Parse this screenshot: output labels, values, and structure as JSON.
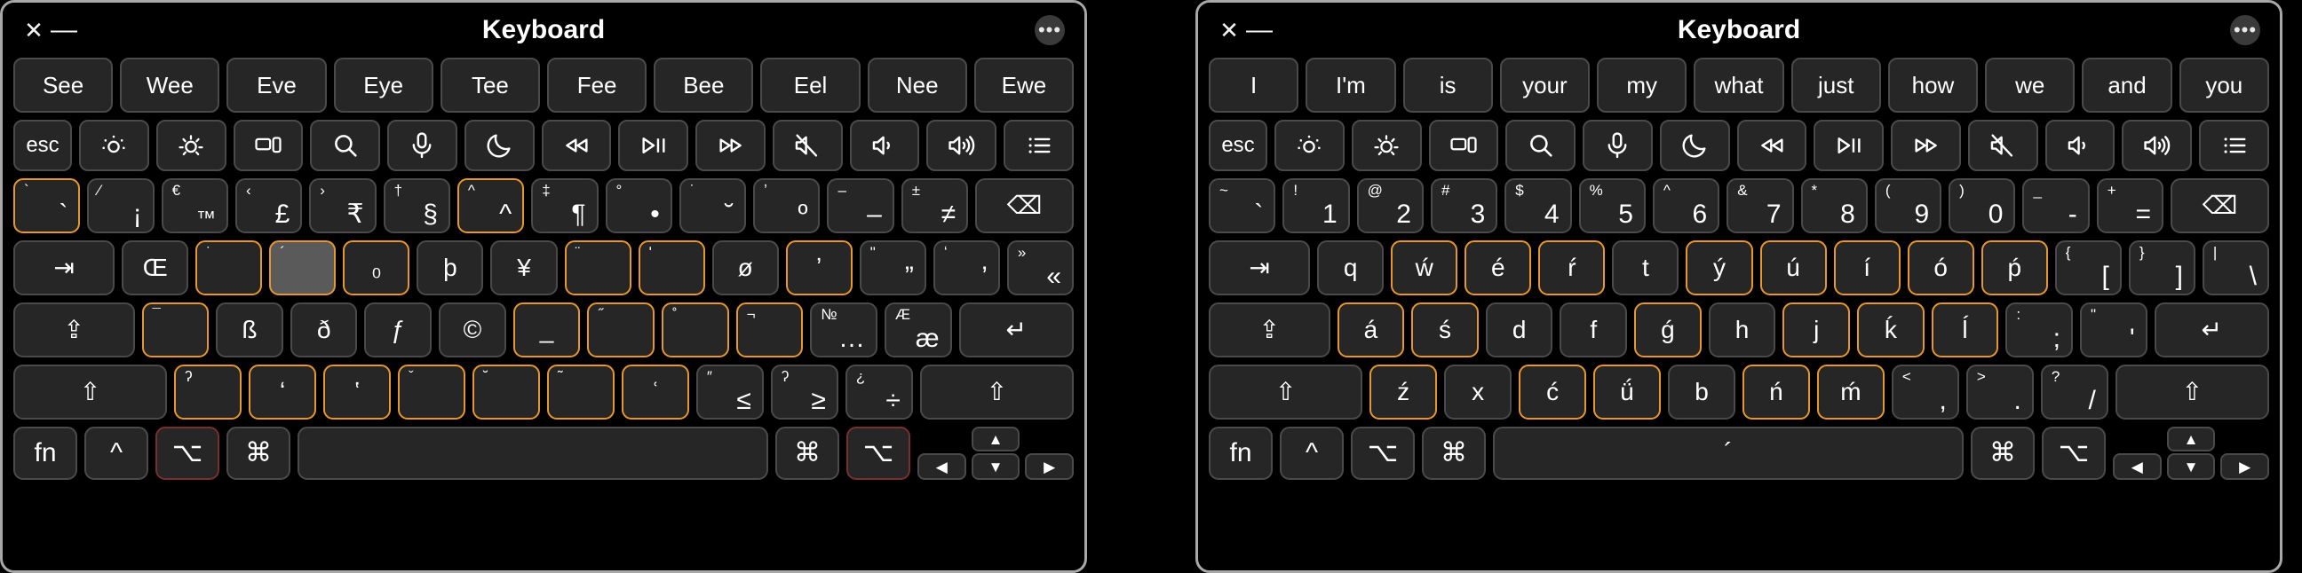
{
  "windows": [
    {
      "id": "left",
      "title": "Keyboard",
      "controls": {
        "close": "✕",
        "minimize": "—",
        "more": "•••"
      },
      "suggestions": [
        "See",
        "Wee",
        "Eve",
        "Eye",
        "Tee",
        "Fee",
        "Bee",
        "Eel",
        "Nee",
        "Ewe"
      ],
      "function_row": [
        {
          "label": "esc",
          "icon": "",
          "name": "escape-key"
        },
        {
          "label": "",
          "icon": "brightness-down-icon",
          "name": "brightness-down-key"
        },
        {
          "label": "",
          "icon": "brightness-up-icon",
          "name": "brightness-up-key"
        },
        {
          "label": "",
          "icon": "mission-control-icon",
          "name": "mission-control-key"
        },
        {
          "label": "",
          "icon": "search-icon",
          "name": "spotlight-key"
        },
        {
          "label": "",
          "icon": "microphone-icon",
          "name": "dictation-key"
        },
        {
          "label": "",
          "icon": "moon-icon",
          "name": "do-not-disturb-key"
        },
        {
          "label": "",
          "icon": "rewind-icon",
          "name": "rewind-key"
        },
        {
          "label": "",
          "icon": "playpause-icon",
          "name": "play-pause-key"
        },
        {
          "label": "",
          "icon": "fastforward-icon",
          "name": "fast-forward-key"
        },
        {
          "label": "",
          "icon": "mute-icon",
          "name": "mute-key"
        },
        {
          "label": "",
          "icon": "volume-down-icon",
          "name": "volume-down-key"
        },
        {
          "label": "",
          "icon": "volume-up-icon",
          "name": "volume-up-key"
        },
        {
          "label": "",
          "icon": "list-icon",
          "name": "list-key"
        }
      ],
      "number_row": [
        {
          "sub": "`",
          "main": "`",
          "state": "dead"
        },
        {
          "sub": "⁄",
          "main": "¡",
          "state": ""
        },
        {
          "sub": "€",
          "main": "™",
          "state": "",
          "mainsmall": true
        },
        {
          "sub": "‹",
          "main": "£",
          "state": ""
        },
        {
          "sub": "›",
          "main": "₹",
          "state": ""
        },
        {
          "sub": "†",
          "main": "§",
          "state": ""
        },
        {
          "sub": "^",
          "main": "^",
          "state": "dead"
        },
        {
          "sub": "‡",
          "main": "¶",
          "state": ""
        },
        {
          "sub": "°",
          "main": "•",
          "state": ""
        },
        {
          "sub": "˙",
          "main": "˘",
          "state": "",
          "subonly2": true
        },
        {
          "sub": "ʼ",
          "main": "º",
          "state": ""
        },
        {
          "sub": "–",
          "main": "–",
          "state": ""
        },
        {
          "sub": "±",
          "main": "≠",
          "state": ""
        },
        {
          "sub": "",
          "main": "⌫",
          "state": "",
          "wide": "bs",
          "name": "backspace-key"
        }
      ],
      "qwerty_row": [
        {
          "main": "⇥",
          "wide": "tab",
          "name": "tab-key"
        },
        {
          "main": "Œ"
        },
        {
          "sub": "˙",
          "main": "",
          "state": "dead"
        },
        {
          "sub": "´",
          "main": "",
          "state": "dead-active"
        },
        {
          "sub": "",
          "main": "₀",
          "state": "dead"
        },
        {
          "main": "þ"
        },
        {
          "main": "¥"
        },
        {
          "sub": "¨",
          "main": "",
          "state": "dead"
        },
        {
          "sub": "ʹ",
          "main": "",
          "state": "dead"
        },
        {
          "main": "ø"
        },
        {
          "sub": "",
          "main": "ʼ",
          "state": "dead"
        },
        {
          "sub": "\"",
          "main": "”"
        },
        {
          "sub": "ʻ",
          "main": "’"
        },
        {
          "sub": "»",
          "main": "«"
        }
      ],
      "home_row": [
        {
          "main": "⇪",
          "wide": "caps",
          "name": "caps-lock-key"
        },
        {
          "sub": "¯",
          "main": "",
          "state": "dead"
        },
        {
          "main": "ß"
        },
        {
          "main": "ð"
        },
        {
          "main": "ƒ"
        },
        {
          "main": "©"
        },
        {
          "sub": "",
          "main": "_",
          "state": "dead"
        },
        {
          "sub": "˝",
          "main": "",
          "state": "dead"
        },
        {
          "sub": "˚",
          "main": "",
          "state": "dead"
        },
        {
          "sub": "¬",
          "main": "",
          "state": "dead"
        },
        {
          "sub": "№",
          "main": "…"
        },
        {
          "sub": "Æ",
          "main": "æ"
        },
        {
          "main": "↵",
          "wide": "ret",
          "name": "return-key"
        }
      ],
      "zx_row": [
        {
          "main": "⇧",
          "wide": "shiftL",
          "name": "shift-left-key"
        },
        {
          "sub": "ʔ",
          "main": "",
          "state": "dead"
        },
        {
          "sub": "",
          "main": "ʻ",
          "state": "dead"
        },
        {
          "sub": "",
          "main": "ʽ",
          "state": "dead"
        },
        {
          "sub": "ˇ",
          "main": "",
          "state": "dead"
        },
        {
          "sub": "˘",
          "main": "",
          "state": "dead"
        },
        {
          "sub": "˜",
          "main": "",
          "state": "dead"
        },
        {
          "sub": "",
          "main": "ʿ",
          "state": "dead"
        },
        {
          "sub": "″",
          "main": "≤"
        },
        {
          "sub": "ʔ",
          "main": "≥"
        },
        {
          "sub": "¿",
          "main": "÷"
        },
        {
          "main": "⇧",
          "wide": "shiftR",
          "name": "shift-right-key"
        }
      ],
      "bottom_row": [
        {
          "main": "fn",
          "name": "fn-key",
          "state": ""
        },
        {
          "main": "^",
          "name": "control-key",
          "state": ""
        },
        {
          "main": "⌥",
          "name": "option-left-key",
          "state": "mod-active"
        },
        {
          "main": "⌘",
          "name": "command-left-key",
          "state": ""
        },
        {
          "main": "",
          "name": "space-key",
          "wide": "sp",
          "state": ""
        },
        {
          "main": "⌘",
          "name": "command-right-key",
          "state": ""
        },
        {
          "main": "⌥",
          "name": "option-right-key",
          "state": "mod-active"
        }
      ],
      "arrows": {
        "up": "▲",
        "left": "◀",
        "down": "▼",
        "right": "▶"
      }
    },
    {
      "id": "right",
      "title": "Keyboard",
      "controls": {
        "close": "✕",
        "minimize": "—",
        "more": "•••"
      },
      "suggestions": [
        "I",
        "I'm",
        "is",
        "your",
        "my",
        "what",
        "just",
        "how",
        "we",
        "and",
        "you"
      ],
      "function_row": [
        {
          "label": "esc",
          "icon": "",
          "name": "escape-key"
        },
        {
          "label": "",
          "icon": "brightness-down-icon",
          "name": "brightness-down-key"
        },
        {
          "label": "",
          "icon": "brightness-up-icon",
          "name": "brightness-up-key"
        },
        {
          "label": "",
          "icon": "mission-control-icon",
          "name": "mission-control-key"
        },
        {
          "label": "",
          "icon": "search-icon",
          "name": "spotlight-key"
        },
        {
          "label": "",
          "icon": "microphone-icon",
          "name": "dictation-key"
        },
        {
          "label": "",
          "icon": "moon-icon",
          "name": "do-not-disturb-key"
        },
        {
          "label": "",
          "icon": "rewind-icon",
          "name": "rewind-key"
        },
        {
          "label": "",
          "icon": "playpause-icon",
          "name": "play-pause-key"
        },
        {
          "label": "",
          "icon": "fastforward-icon",
          "name": "fast-forward-key"
        },
        {
          "label": "",
          "icon": "mute-icon",
          "name": "mute-key"
        },
        {
          "label": "",
          "icon": "volume-down-icon",
          "name": "volume-down-key"
        },
        {
          "label": "",
          "icon": "volume-up-icon",
          "name": "volume-up-key"
        },
        {
          "label": "",
          "icon": "list-icon",
          "name": "list-key"
        }
      ],
      "number_row": [
        {
          "sub": "~",
          "main": "`",
          "state": ""
        },
        {
          "sub": "!",
          "main": "1",
          "state": ""
        },
        {
          "sub": "@",
          "main": "2",
          "state": ""
        },
        {
          "sub": "#",
          "main": "3",
          "state": ""
        },
        {
          "sub": "$",
          "main": "4",
          "state": ""
        },
        {
          "sub": "%",
          "main": "5",
          "state": ""
        },
        {
          "sub": "^",
          "main": "6",
          "state": ""
        },
        {
          "sub": "&",
          "main": "7",
          "state": ""
        },
        {
          "sub": "*",
          "main": "8",
          "state": ""
        },
        {
          "sub": "(",
          "main": "9",
          "state": ""
        },
        {
          "sub": ")",
          "main": "0",
          "state": ""
        },
        {
          "sub": "_",
          "main": "-",
          "state": ""
        },
        {
          "sub": "+",
          "main": "=",
          "state": ""
        },
        {
          "sub": "",
          "main": "⌫",
          "state": "",
          "wide": "bs",
          "name": "backspace-key"
        }
      ],
      "qwerty_row": [
        {
          "main": "⇥",
          "wide": "tab",
          "name": "tab-key"
        },
        {
          "main": "q"
        },
        {
          "main": "ẃ",
          "state": "dead"
        },
        {
          "main": "é",
          "state": "dead"
        },
        {
          "main": "ŕ",
          "state": "dead"
        },
        {
          "main": "t"
        },
        {
          "main": "ý",
          "state": "dead"
        },
        {
          "main": "ú",
          "state": "dead"
        },
        {
          "main": "í",
          "state": "dead"
        },
        {
          "main": "ó",
          "state": "dead"
        },
        {
          "main": "ṕ",
          "state": "dead"
        },
        {
          "sub": "{",
          "main": "["
        },
        {
          "sub": "}",
          "main": "]"
        },
        {
          "sub": "|",
          "main": "\\"
        }
      ],
      "home_row": [
        {
          "main": "⇪",
          "wide": "caps",
          "name": "caps-lock-key"
        },
        {
          "main": "á",
          "state": "dead"
        },
        {
          "main": "ś",
          "state": "dead"
        },
        {
          "main": "d"
        },
        {
          "main": "f"
        },
        {
          "main": "ǵ",
          "state": "dead"
        },
        {
          "main": "h"
        },
        {
          "main": "j",
          "state": "dead"
        },
        {
          "main": "ḱ",
          "state": "dead"
        },
        {
          "main": "ĺ",
          "state": "dead"
        },
        {
          "sub": ":",
          "main": ";"
        },
        {
          "sub": "\"",
          "main": "'"
        },
        {
          "main": "↵",
          "wide": "ret",
          "name": "return-key"
        }
      ],
      "zx_row": [
        {
          "main": "⇧",
          "wide": "shiftL",
          "name": "shift-left-key"
        },
        {
          "main": "ź",
          "state": "dead"
        },
        {
          "main": "x"
        },
        {
          "main": "ć",
          "state": "dead"
        },
        {
          "main": "ǘ",
          "state": "dead"
        },
        {
          "main": "b"
        },
        {
          "main": "ń",
          "state": "dead"
        },
        {
          "main": "ḿ",
          "state": "dead"
        },
        {
          "sub": "<",
          "main": ","
        },
        {
          "sub": ">",
          "main": "."
        },
        {
          "sub": "?",
          "main": "/"
        },
        {
          "main": "⇧",
          "wide": "shiftR",
          "name": "shift-right-key"
        }
      ],
      "bottom_row": [
        {
          "main": "fn",
          "name": "fn-key",
          "state": ""
        },
        {
          "main": "^",
          "name": "control-key",
          "state": ""
        },
        {
          "main": "⌥",
          "name": "option-left-key",
          "state": ""
        },
        {
          "main": "⌘",
          "name": "command-left-key",
          "state": ""
        },
        {
          "main": "´",
          "name": "space-key",
          "wide": "sp",
          "state": ""
        },
        {
          "main": "⌘",
          "name": "command-right-key",
          "state": ""
        },
        {
          "main": "⌥",
          "name": "option-right-key",
          "state": ""
        }
      ],
      "arrows": {
        "up": "▲",
        "left": "◀",
        "down": "▼",
        "right": "▶"
      }
    }
  ],
  "colors": {
    "background": "#000000",
    "key_face": "#262626",
    "key_border": "#4a4a4a",
    "dead_key_border": "#e8962e",
    "dead_key_active_face": "#5a5a5a",
    "modifier_active_border": "#7a2f2f",
    "text": "#ffffff",
    "window_border": "#a8a8a8"
  }
}
